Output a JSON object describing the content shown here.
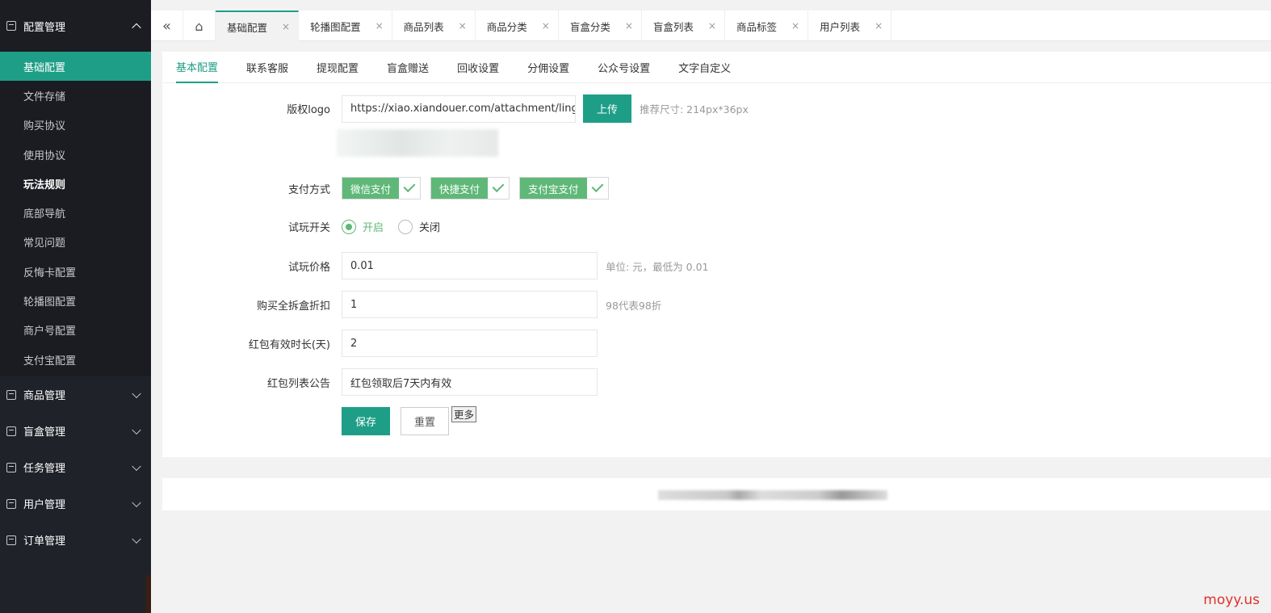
{
  "sidebar": {
    "groups": [
      {
        "label": "配置管理",
        "icon": "settings-doc-icon",
        "expanded": true
      },
      {
        "label": "商品管理",
        "icon": "goods-icon"
      },
      {
        "label": "盲盒管理",
        "icon": "gift-icon"
      },
      {
        "label": "任务管理",
        "icon": "task-icon"
      },
      {
        "label": "用户管理",
        "icon": "user-icon"
      },
      {
        "label": "订单管理",
        "icon": "order-icon"
      }
    ],
    "config_items": [
      "基础配置",
      "文件存储",
      "购买协议",
      "使用协议",
      "玩法规则",
      "底部导航",
      "常见问题",
      "反悔卡配置",
      "轮播图配置",
      "商户号配置",
      "支付宝配置"
    ]
  },
  "topbar": {
    "tabs": [
      "基础配置",
      "轮播图配置",
      "商品列表",
      "商品分类",
      "盲盒分类",
      "盲盒列表",
      "商品标签",
      "用户列表"
    ],
    "close": "×"
  },
  "subtabs": [
    "基本配置",
    "联系客服",
    "提现配置",
    "盲盒赠送",
    "回收设置",
    "分佣设置",
    "公众号设置",
    "文字自定义"
  ],
  "form": {
    "logo": {
      "label": "版权logo",
      "value": "https://xiao.xiandouer.com/attachment/lingchi_blind",
      "upload": "上传",
      "hint": "推荐尺寸: 214px*36px"
    },
    "pay": {
      "label": "支付方式",
      "options": [
        "微信支付",
        "快捷支付",
        "支付宝支付"
      ]
    },
    "trial_switch": {
      "label": "试玩开关",
      "on": "开启",
      "off": "关闭",
      "selected": "开启"
    },
    "trial_price": {
      "label": "试玩价格",
      "value": "0.01",
      "hint": "单位: 元，最低为 0.01"
    },
    "discount": {
      "label": "购买全拆盒折扣",
      "value": "1",
      "hint": "98代表98折"
    },
    "redpack_days": {
      "label": "红包有效时长(天)",
      "value": "2"
    },
    "redpack_notice": {
      "label": "红包列表公告",
      "value": "红包领取后7天内有效"
    },
    "save": "保存",
    "reset": "重置",
    "more": "更多"
  },
  "watermark": "moyy.us",
  "colors": {
    "accent": "#1e9e87",
    "check_green": "#5fb878",
    "sidebar_bg": "#20222a"
  }
}
